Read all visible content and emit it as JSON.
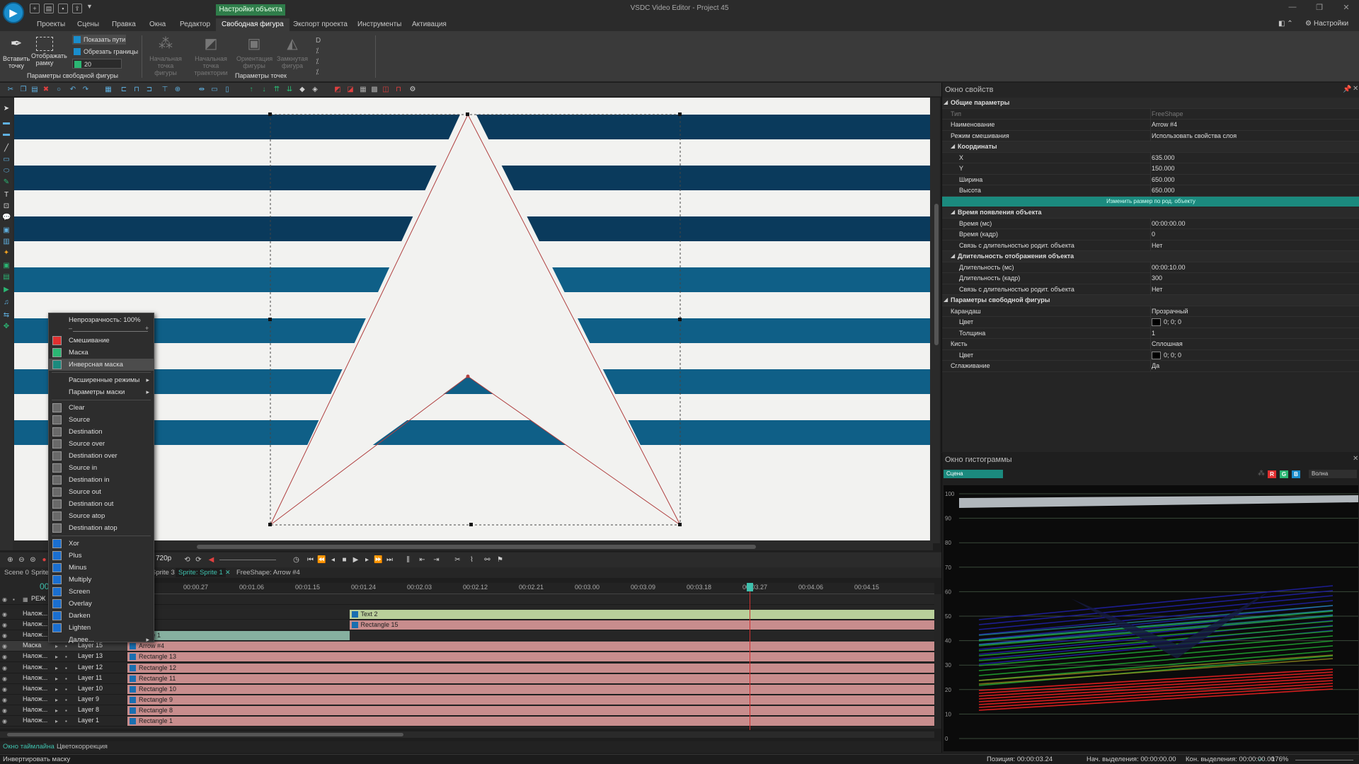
{
  "app": {
    "window_title": "VSDC Video Editor - Project 45"
  },
  "menu": {
    "tabs": [
      "Проекты",
      "Сцены",
      "Правка",
      "Окна",
      "Редактор",
      "Свободная фигура",
      "Экспорт проекта",
      "Инструменты",
      "Активация"
    ],
    "active_tab": "Свободная фигура",
    "context_header": "Настройки объекта",
    "settings_label": "Настройки"
  },
  "ribbon": {
    "insert_point": "Вставить точку",
    "show_frame": "Отображать рамку",
    "show_paths": "Показать пути",
    "clip_bounds": "Обрезать границы",
    "spin_value": "20",
    "group1_label": "Параметры свободной фигуры",
    "start_point": "Начальная точка фигуры",
    "start_path": "Начальная точка траектории",
    "orientation": "Ориентация фигуры",
    "closed": "Замкнутая фигура",
    "group2_label": "Параметры точек"
  },
  "context_menu": {
    "opacity": "Непрозрачность: 100%",
    "items_top": [
      "Смешивание",
      "Маска",
      "Инверсная маска"
    ],
    "submenus": [
      "Расширенные режимы",
      "Параметры маски"
    ],
    "compositing": [
      "Clear",
      "Source",
      "Destination",
      "Source over",
      "Destination over",
      "Source in",
      "Destination in",
      "Source out",
      "Destination out",
      "Source atop",
      "Destination atop"
    ],
    "blend": [
      "Xor",
      "Plus",
      "Minus",
      "Multiply",
      "Screen",
      "Overlay",
      "Darken",
      "Lighten",
      "Далее..."
    ],
    "highlighted": "Инверсная маска"
  },
  "playback": {
    "resolution": "720р"
  },
  "scene_tabs": [
    "Scene 0",
    "Sprite",
    "Sprite 3",
    "Sprite: Sprite 1",
    "FreeShape: Arrow #4"
  ],
  "timeline": {
    "time_readout": "00",
    "mode_header": "РЕЖ",
    "ruler": [
      "00:00.18",
      "00:00.27",
      "00:01.06",
      "00:01.15",
      "00:01.24",
      "00:02.03",
      "00:02.12",
      "00:02.21",
      "00:03.00",
      "00:03.09",
      "00:03.18",
      "00:03.27",
      "00:04.06",
      "00:04.15"
    ],
    "tracks": [
      {
        "mode": "Налож...",
        "layer": "",
        "clip": "Text 2",
        "clip_color": "#b9cf9a",
        "clip_from": 0.275
      },
      {
        "mode": "Налож...",
        "layer": "",
        "clip": "Rectangle 15",
        "clip_color": "#c88d8d",
        "clip_from": 0.275
      },
      {
        "mode": "Налож...",
        "layer": "",
        "clip": "ective 1",
        "clip_color": "#86b0a0",
        "clip_from": 0.0,
        "clip_to": 0.275
      },
      {
        "mode": "Маска",
        "layer": "Layer 15",
        "clip": "Arrow #4",
        "clip_color": "#c88d8d",
        "clip_from": 0.0
      },
      {
        "mode": "Налож...",
        "layer": "Layer 13",
        "clip": "Rectangle 13",
        "clip_color": "#c88d8d",
        "clip_from": 0.0
      },
      {
        "mode": "Налож...",
        "layer": "Layer 12",
        "clip": "Rectangle 12",
        "clip_color": "#c88d8d",
        "clip_from": 0.0
      },
      {
        "mode": "Налож...",
        "layer": "Layer 11",
        "clip": "Rectangle 11",
        "clip_color": "#c88d8d",
        "clip_from": 0.0
      },
      {
        "mode": "Налож...",
        "layer": "Layer 10",
        "clip": "Rectangle 10",
        "clip_color": "#c88d8d",
        "clip_from": 0.0
      },
      {
        "mode": "Налож...",
        "layer": "Layer 9",
        "clip": "Rectangle 9",
        "clip_color": "#c88d8d",
        "clip_from": 0.0
      },
      {
        "mode": "Налож...",
        "layer": "Layer 8",
        "clip": "Rectangle 8",
        "clip_color": "#c88d8d",
        "clip_from": 0.0
      },
      {
        "mode": "Налож...",
        "layer": "Layer 1",
        "clip": "Rectangle 1",
        "clip_color": "#c88d8d",
        "clip_from": 0.0
      }
    ]
  },
  "bottom_tabs": [
    "Окно таймлайна",
    "Цветокоррекция"
  ],
  "status": {
    "message": "Инвертировать маску",
    "position": "Позиция:  00:00:03.24",
    "sel_start": "Нач. выделения:  00:00:00.00",
    "sel_end": "Кон. выделения:  00:00:00.00",
    "zoom": "176%"
  },
  "properties": {
    "title": "Окно свойств",
    "resize_btn": "Изменить размер по род. объекту",
    "rows": [
      {
        "kind": "section",
        "name": "Общие параметры"
      },
      {
        "kind": "prop",
        "name": "Тип",
        "value": "FreeShape",
        "dim": true
      },
      {
        "kind": "prop",
        "name": "Наименование",
        "value": "Arrow #4"
      },
      {
        "kind": "prop",
        "name": "Режим смешивания",
        "value": "Использовать свойства слоя"
      },
      {
        "kind": "subsection",
        "name": "Координаты"
      },
      {
        "kind": "prop2",
        "name": "X",
        "value": "635.000"
      },
      {
        "kind": "prop2",
        "name": "Y",
        "value": "150.000"
      },
      {
        "kind": "prop2",
        "name": "Ширина",
        "value": "650.000"
      },
      {
        "kind": "prop2",
        "name": "Высота",
        "value": "650.000"
      },
      {
        "kind": "button"
      },
      {
        "kind": "subsection",
        "name": "Время появления объекта"
      },
      {
        "kind": "prop2",
        "name": "Время (мс)",
        "value": "00:00:00.00"
      },
      {
        "kind": "prop2",
        "name": "Время (кадр)",
        "value": "0"
      },
      {
        "kind": "prop2",
        "name": "Связь с длительностью родит. объекта",
        "value": "Нет"
      },
      {
        "kind": "subsection",
        "name": "Длительность отображения объекта"
      },
      {
        "kind": "prop2",
        "name": "Длительность (мс)",
        "value": "00:00:10.00"
      },
      {
        "kind": "prop2",
        "name": "Длительность (кадр)",
        "value": "300"
      },
      {
        "kind": "prop2",
        "name": "Связь с длительностью родит. объекта",
        "value": "Нет"
      },
      {
        "kind": "section",
        "name": "Параметры свободной фигуры"
      },
      {
        "kind": "prop",
        "name": "Карандаш",
        "value": "Прозрачный"
      },
      {
        "kind": "prop2",
        "name": "Цвет",
        "value": "0; 0; 0",
        "swatch": true
      },
      {
        "kind": "prop2",
        "name": "Толщина",
        "value": "1"
      },
      {
        "kind": "prop",
        "name": "Кисть",
        "value": "Сплошная"
      },
      {
        "kind": "prop2",
        "name": "Цвет",
        "value": "0; 0; 0",
        "swatch": true
      },
      {
        "kind": "prop",
        "name": "Сглаживание",
        "value": "Да"
      }
    ]
  },
  "histogram": {
    "title": "Окно гистограммы",
    "source": "Сцена",
    "mode": "Волна",
    "channels": [
      "R",
      "G",
      "B"
    ],
    "y_ticks": [
      "100",
      "90",
      "80",
      "70",
      "60",
      "50",
      "40",
      "30",
      "20",
      "10",
      "0"
    ]
  },
  "colors": {
    "accent": "#3fc1ae",
    "stripe_dark": "#0a3a5c",
    "stripe_mid": "#0f5f87",
    "stripe_light": "#f2f2f0"
  }
}
